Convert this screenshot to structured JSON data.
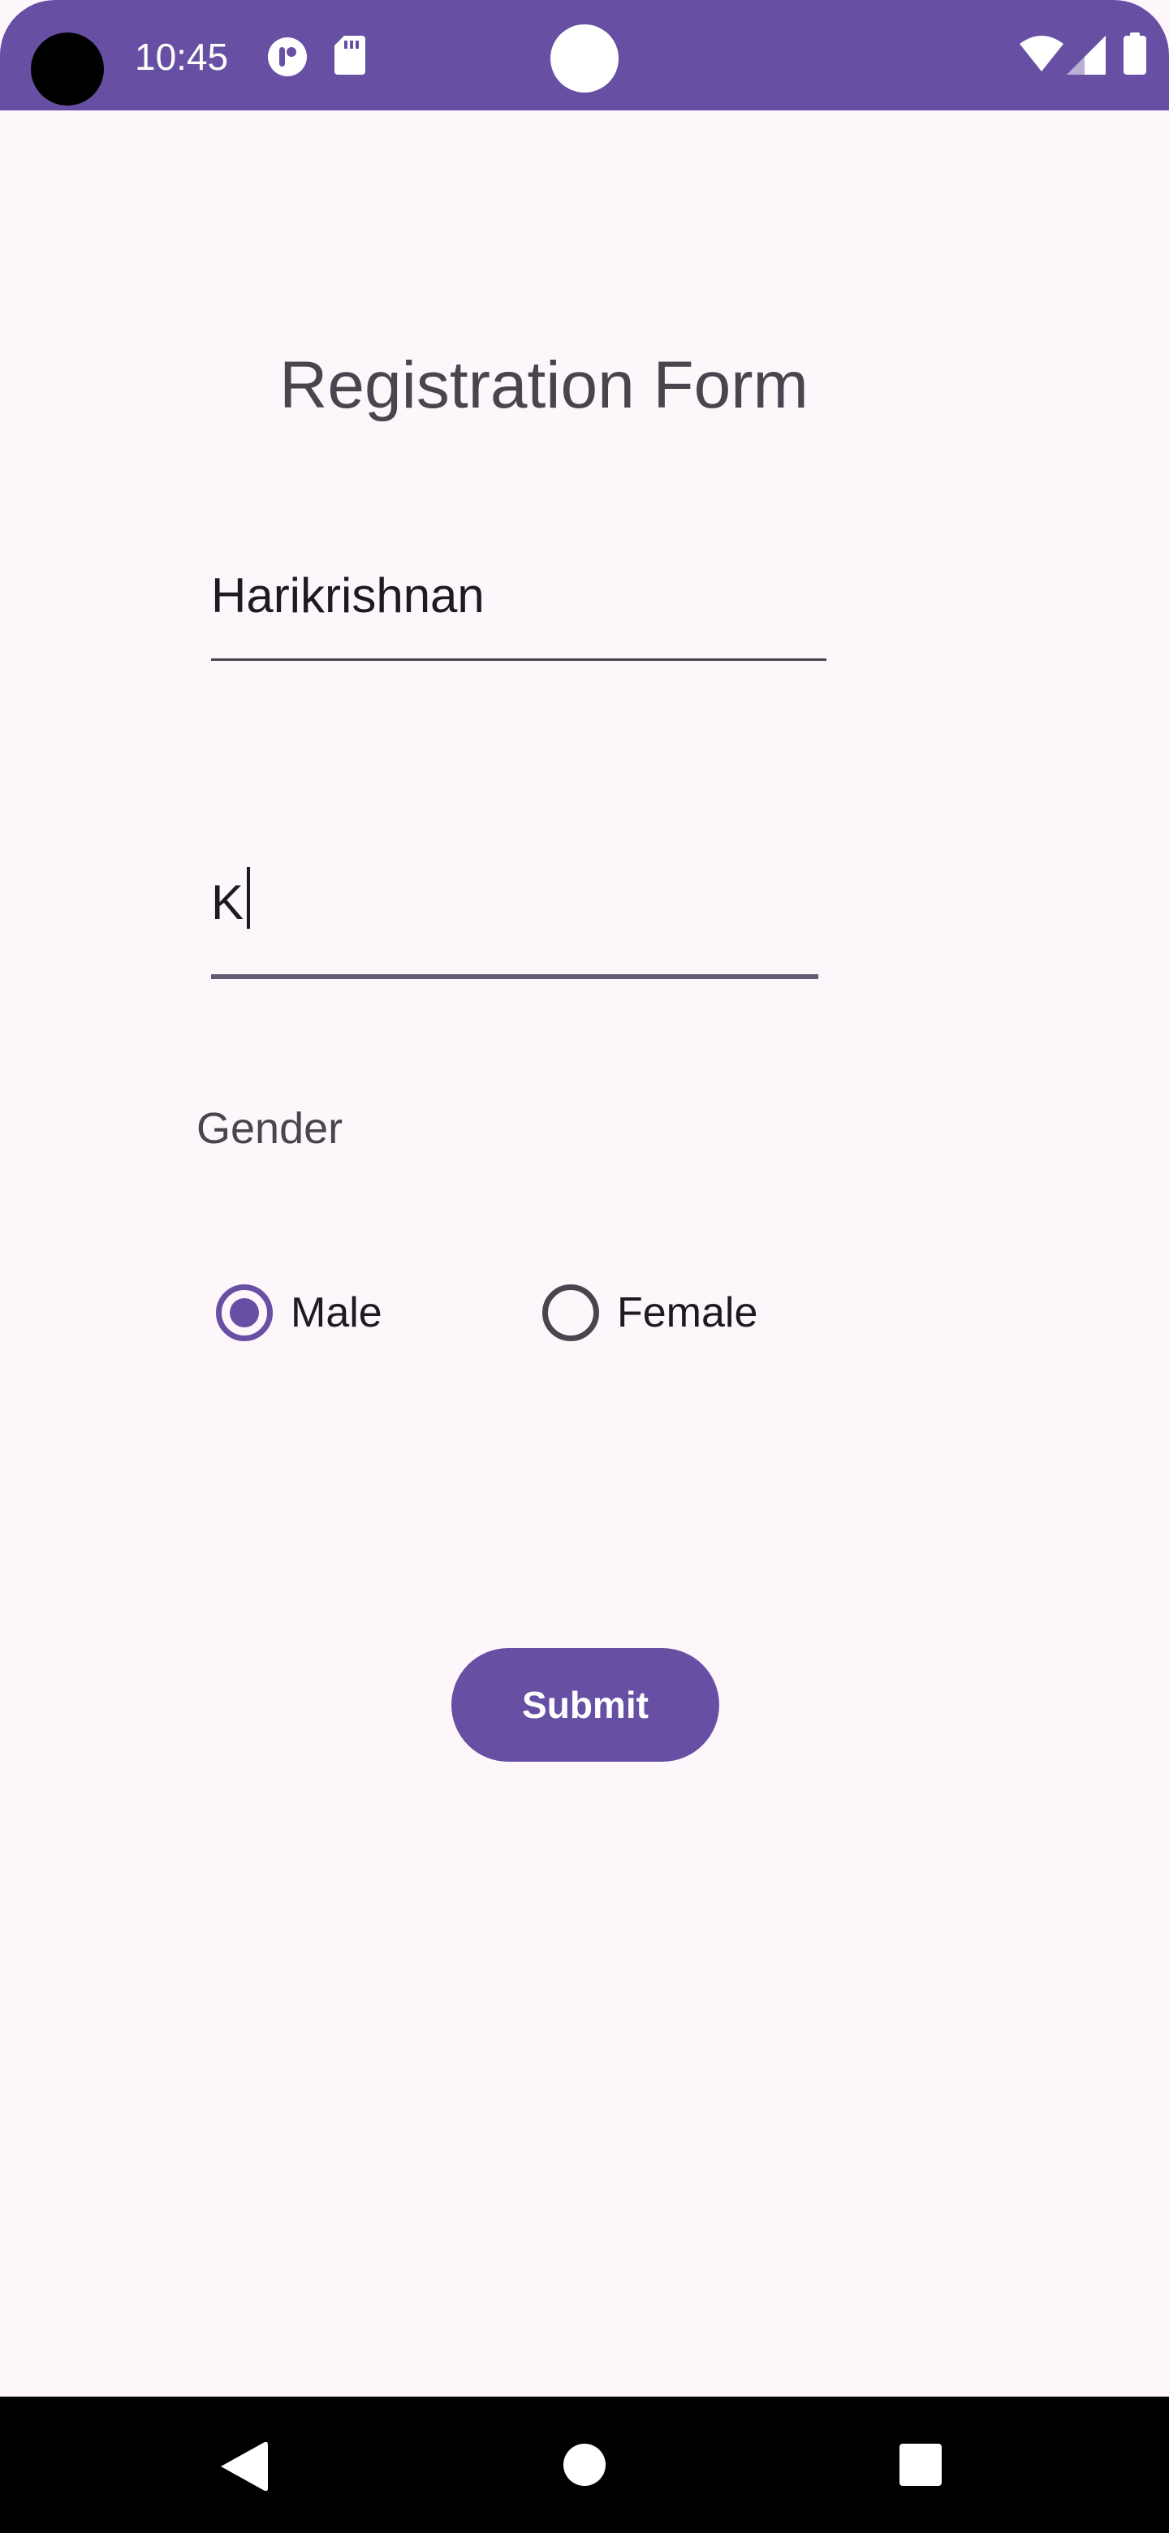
{
  "status_bar": {
    "time": "10:45",
    "background_color": "#6750a4",
    "icons": [
      "camera-cutout",
      "notification-app-icon",
      "sd-card-icon",
      "wifi-icon",
      "cellular-signal-icon",
      "battery-icon"
    ]
  },
  "form": {
    "title": "Registration Form",
    "first_name_value": "Harikrishnan",
    "last_name_value": "K",
    "gender_label": "Gender",
    "gender_options": [
      {
        "label": "Male",
        "selected": true
      },
      {
        "label": "Female",
        "selected": false
      }
    ],
    "submit_label": "Submit"
  },
  "colors": {
    "accent": "#6750a4",
    "background": "#fdf7fc",
    "text": "#1d1b20",
    "secondary_text": "#48454e"
  },
  "nav_bar": {
    "icons": [
      "back-icon",
      "home-icon",
      "recents-icon"
    ]
  }
}
